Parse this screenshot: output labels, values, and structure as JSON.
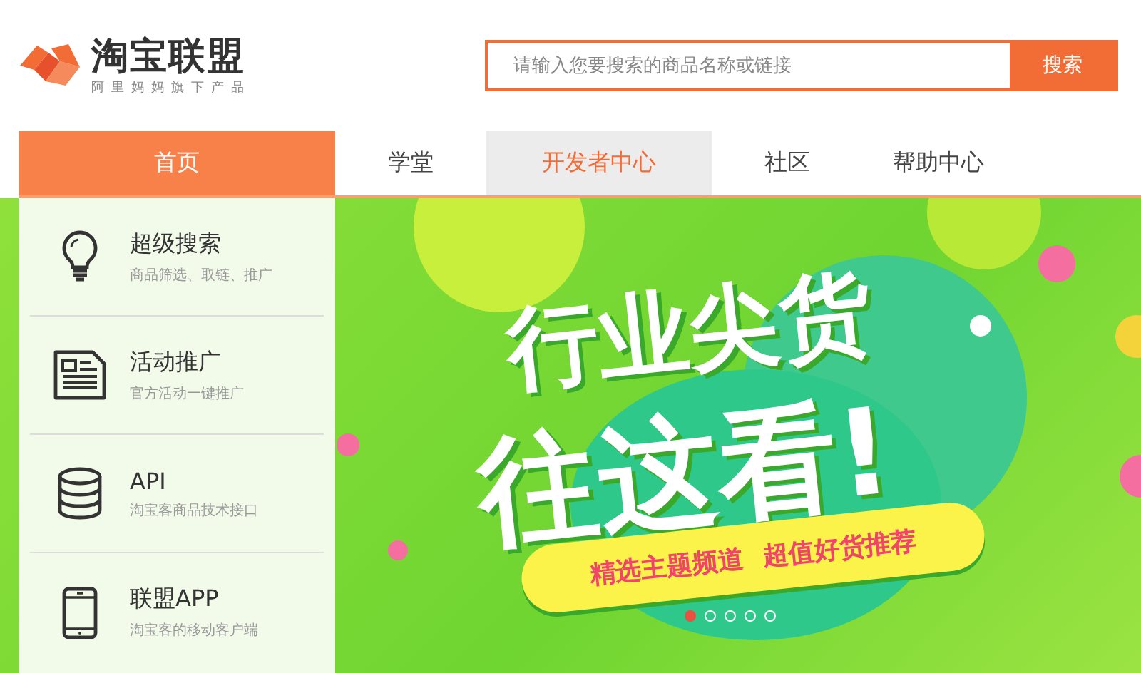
{
  "logo": {
    "name": "淘宝联盟",
    "tagline": "阿里妈妈旗下产品"
  },
  "search": {
    "placeholder": "请输入您要搜索的商品名称或链接",
    "button": "搜索"
  },
  "tabs": [
    {
      "label": "首页",
      "selected": true,
      "highlighted": false
    },
    {
      "label": "学堂",
      "selected": false,
      "highlighted": false
    },
    {
      "label": "开发者中心",
      "selected": false,
      "highlighted": true
    },
    {
      "label": "社区",
      "selected": false,
      "highlighted": false
    },
    {
      "label": "帮助中心",
      "selected": false,
      "highlighted": false
    }
  ],
  "sidebar": {
    "items": [
      {
        "kind": "bulb",
        "title": "超级搜索",
        "subtitle": "商品筛选、取链、推广"
      },
      {
        "kind": "document",
        "title": "活动推广",
        "subtitle": "官方活动一键推广"
      },
      {
        "kind": "database",
        "title": "API",
        "subtitle": "淘宝客商品技术接口"
      },
      {
        "kind": "phone",
        "title": "联盟APP",
        "subtitle": "淘宝客的移动客户端"
      }
    ]
  },
  "banner": {
    "headline_1": "行业尖货",
    "headline_2": "往这看!",
    "tagline_1": "精选主题频道",
    "tagline_2": "超值好货推荐",
    "dots": [
      {
        "selected": true
      },
      {
        "selected": false
      },
      {
        "selected": false
      },
      {
        "selected": false
      },
      {
        "selected": false
      }
    ]
  }
}
